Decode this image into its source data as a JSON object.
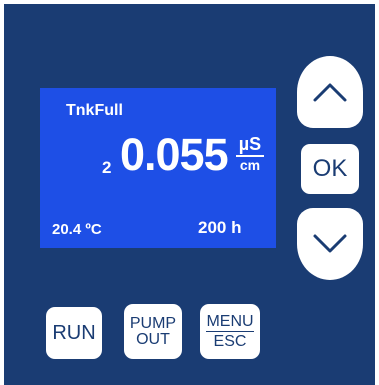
{
  "display": {
    "status": "TnkFull",
    "channel": "2",
    "reading": "0.055",
    "unit_numerator": "µS",
    "unit_denominator": "cm",
    "temperature": "20.4 ºC",
    "hours": "200 h"
  },
  "keys": {
    "up_icon": "chevron-up-icon",
    "ok": "OK",
    "down_icon": "chevron-down-icon",
    "run": "RUN",
    "pump_top": "PUMP",
    "pump_bottom": "OUT",
    "menu_top": "MENU",
    "menu_bottom": "ESC"
  },
  "colors": {
    "panel": "#1a3c73",
    "lcd": "#1e4fe6",
    "key": "#ffffff"
  }
}
